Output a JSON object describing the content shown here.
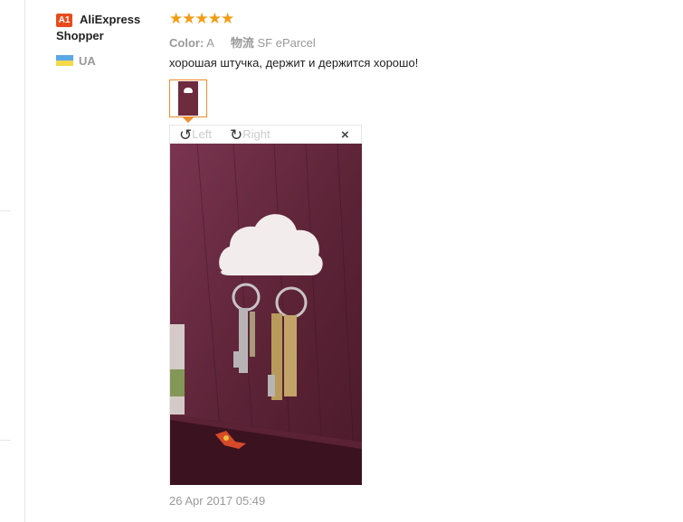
{
  "reviewer": {
    "badge": "A1",
    "name": "AliExpress Shopper",
    "country": "UA",
    "flag_colors": [
      "#5aa8e8",
      "#f4d94a"
    ]
  },
  "review": {
    "stars_label": "★★★★★",
    "rating": 5,
    "color_label": "Color:",
    "color_value": "A",
    "shipping_label": "物流",
    "shipping_value": "SF eParcel",
    "text": "хорошая штучка, держит и держится хорошо!",
    "date": "26 Apr 2017 05:49"
  },
  "viewer": {
    "rotate_left": "Left",
    "rotate_right": "Right",
    "close": "×",
    "rotate_left_icon": "rotate-ccw-icon",
    "rotate_right_icon": "rotate-cw-icon"
  },
  "colors": {
    "accent": "#f08c2a",
    "star": "#f49c12",
    "badge": "#e84b1b",
    "muted": "#999999"
  }
}
